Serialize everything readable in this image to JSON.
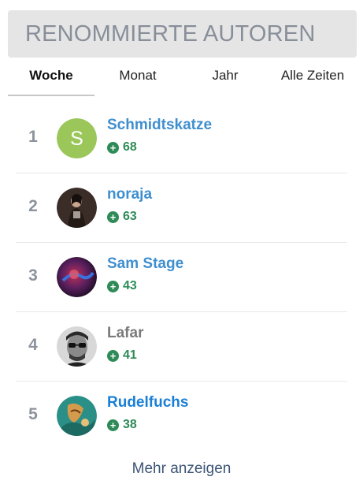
{
  "header": {
    "title": "RENOMMIERTE AUTOREN"
  },
  "tabs": [
    {
      "label": "Woche",
      "active": true
    },
    {
      "label": "Monat",
      "active": false
    },
    {
      "label": "Jahr",
      "active": false
    },
    {
      "label": "Alle Zeiten",
      "active": false
    }
  ],
  "authors": [
    {
      "rank": "1",
      "name": "Schmidtskatze",
      "score": "68",
      "avatar_letter": "S",
      "avatar_icon": "letter-avatar",
      "name_color": "#3f8fcf"
    },
    {
      "rank": "2",
      "name": "noraja",
      "score": "63",
      "avatar_icon": "photo-avatar",
      "name_color": "#3f8fcf"
    },
    {
      "rank": "3",
      "name": "Sam Stage",
      "score": "43",
      "avatar_icon": "photo-avatar",
      "name_color": "#3f8fcf"
    },
    {
      "rank": "4",
      "name": "Lafar",
      "score": "41",
      "avatar_icon": "photo-avatar",
      "name_color": "#7a7a7a"
    },
    {
      "rank": "5",
      "name": "Rudelfuchs",
      "score": "38",
      "avatar_icon": "photo-avatar",
      "name_color": "#1a7fd6"
    }
  ],
  "footer": {
    "more_label": "Mehr anzeigen"
  },
  "colors": {
    "header_bg": "#e5e5e5",
    "score_green": "#2e8b57",
    "link_blue": "#3f8fcf"
  }
}
